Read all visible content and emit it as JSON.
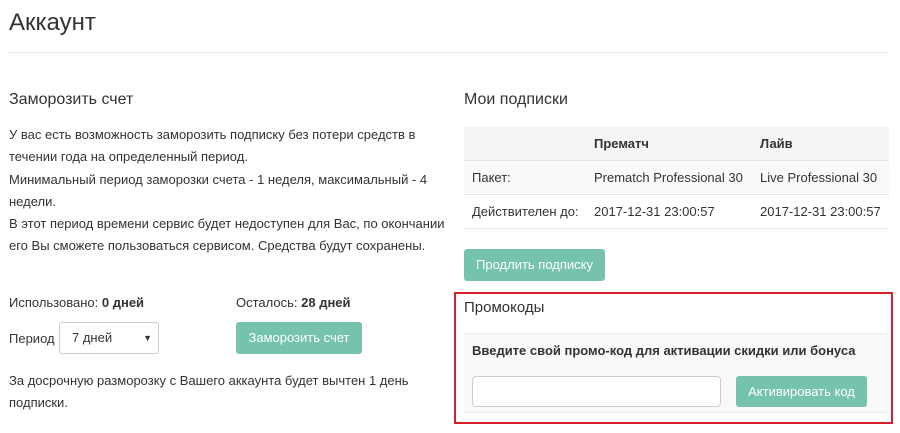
{
  "page": {
    "title": "Аккаунт"
  },
  "freeze": {
    "title": "Заморозить счет",
    "paragraphs": [
      "У вас есть возможность заморозить подписку без потери средств в течении года на определенный период.",
      "Минимальный период заморозки счета - 1 неделя, максимальный - 4 недели.",
      "В этот период времени сервис будет недоступен для Вас, по окончании его Вы сможете пользоваться сервисом. Средства будут сохранены."
    ],
    "used_label": "Использовано:",
    "used_value": "0 дней",
    "left_label": "Осталось:",
    "left_value": "28 дней",
    "period_label": "Период",
    "period_value": "7 дней",
    "freeze_button": "Заморозить счет",
    "note": "За досрочную разморозку с Вашего аккаунта будет вычтен 1 день подписки."
  },
  "subscriptions": {
    "title": "Мои подписки",
    "columns": [
      "",
      "Прематч",
      "Лайв"
    ],
    "rows": [
      [
        "Пакет:",
        "Prematch Professional 30",
        "Live Professional 30"
      ],
      [
        "Действителен до:",
        "2017-12-31 23:00:57",
        "2017-12-31 23:00:57"
      ]
    ],
    "extend_button": "Продлить подписку"
  },
  "promo": {
    "title": "Промокоды",
    "label": "Введите свой промо-код для активации скидки или бонуса",
    "input_value": "",
    "input_placeholder": "",
    "activate_button": "Активировать код"
  },
  "colors": {
    "button": "#76c3ad",
    "highlight_border": "#d6212d"
  }
}
